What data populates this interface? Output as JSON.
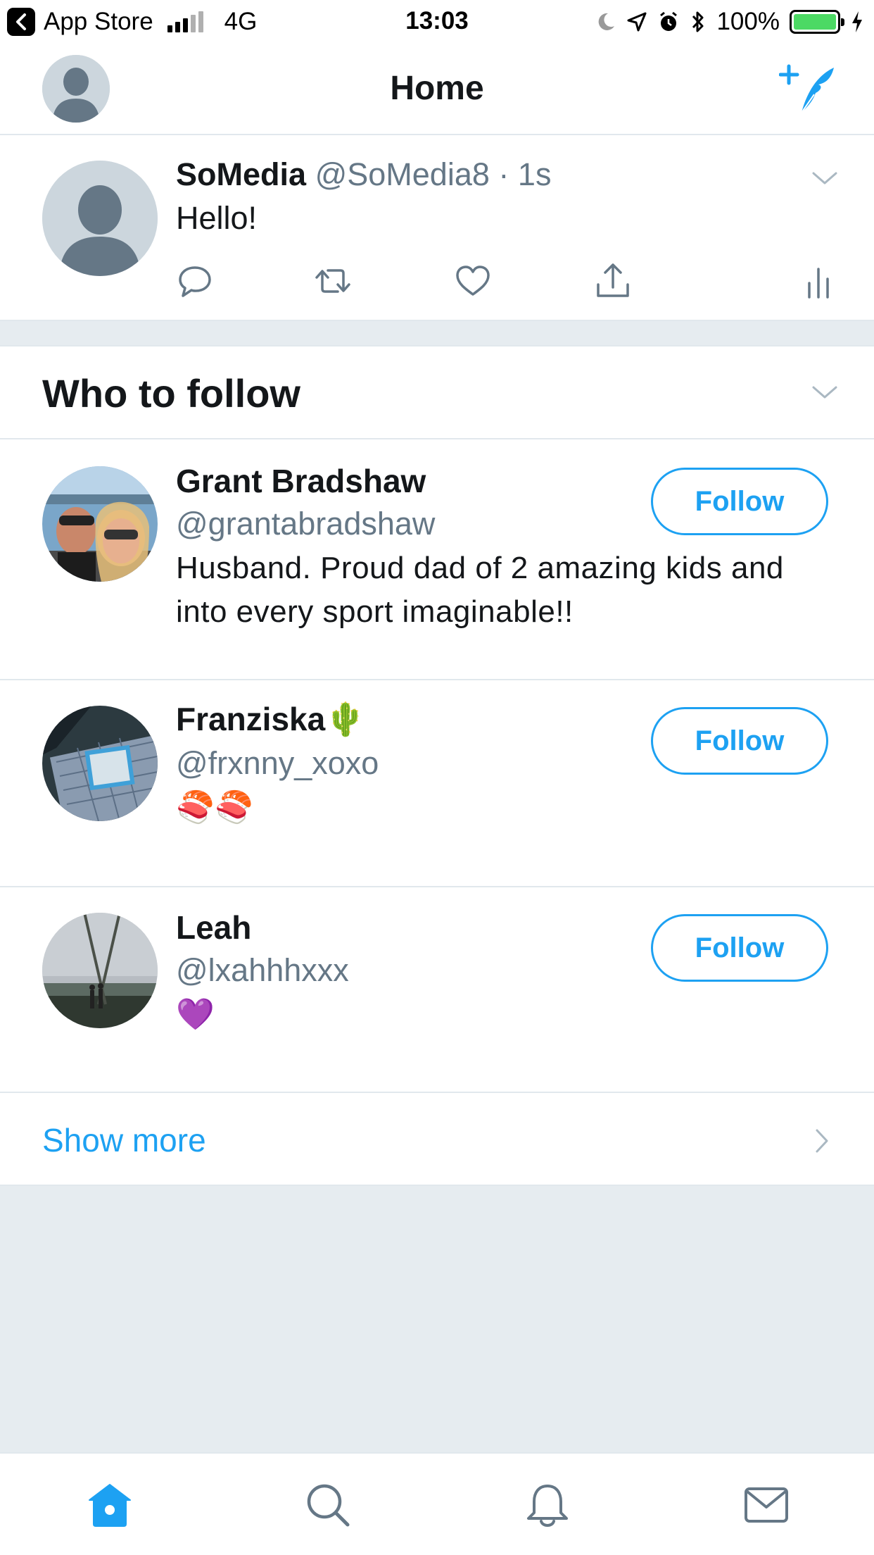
{
  "status_bar": {
    "back_app": "App Store",
    "network": "4G",
    "time": "13:03",
    "battery": "100%",
    "battery_color": "#4cd964"
  },
  "nav": {
    "title": "Home",
    "left_icon": "profile-avatar-icon",
    "right_icon": "compose-tweet-icon"
  },
  "tweet": {
    "name": "SoMedia",
    "handle": "@SoMedia8",
    "separator": "·",
    "time": "1s",
    "text": "Hello!",
    "actions": [
      "reply-icon",
      "retweet-icon",
      "like-icon",
      "share-icon",
      "analytics-icon"
    ]
  },
  "who_to_follow": {
    "title": "Who to follow",
    "users": [
      {
        "name": "Grant Bradshaw",
        "handle": "@grantabradshaw",
        "bio": "Husband. Proud dad of 2 amazing kids and into every sport imaginable!!",
        "follow_label": "Follow"
      },
      {
        "name": "Franziska🌵",
        "handle": "@frxnny_xoxo",
        "bio": "🍣🍣",
        "follow_label": "Follow"
      },
      {
        "name": "Leah",
        "handle": "@lxahhhxxx",
        "bio": "💜",
        "follow_label": "Follow"
      }
    ],
    "show_more": "Show more"
  },
  "tab_bar": {
    "tabs": [
      "home-icon",
      "search-icon",
      "notifications-icon",
      "messages-icon"
    ],
    "active": "home-icon",
    "active_color": "#1da1f2",
    "inactive_color": "#657786"
  }
}
